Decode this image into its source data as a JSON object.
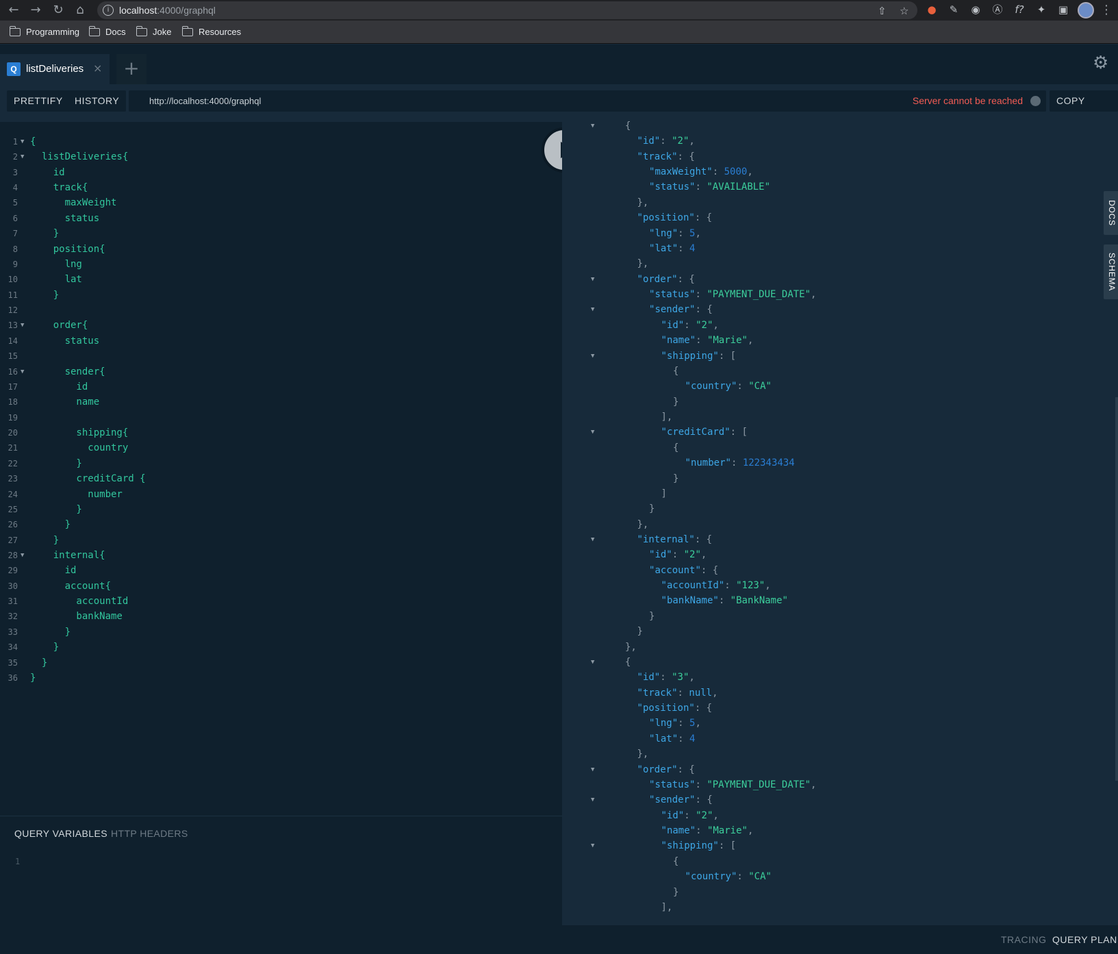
{
  "browser": {
    "url_host": "localhost",
    "url_rest": ":4000/graphql",
    "bookmarks": [
      "Programming",
      "Docs",
      "Joke",
      "Resources"
    ]
  },
  "playground": {
    "tab": {
      "badge": "Q",
      "label": "listDeliveries"
    },
    "toolbar": {
      "prettify": "PRETTIFY",
      "history": "HISTORY",
      "endpoint": "http://localhost:4000/graphql",
      "status": "Server cannot be reached",
      "copy_curl": "COPY CURL"
    },
    "query_lines": [
      {
        "n": "1",
        "fold": true,
        "text": "{"
      },
      {
        "n": "2",
        "fold": true,
        "text": "  listDeliveries{"
      },
      {
        "n": "3",
        "fold": false,
        "text": "    id"
      },
      {
        "n": "4",
        "fold": false,
        "text": "    track{"
      },
      {
        "n": "5",
        "fold": false,
        "text": "      maxWeight"
      },
      {
        "n": "6",
        "fold": false,
        "text": "      status"
      },
      {
        "n": "7",
        "fold": false,
        "text": "    }"
      },
      {
        "n": "8",
        "fold": false,
        "text": "    position{"
      },
      {
        "n": "9",
        "fold": false,
        "text": "      lng"
      },
      {
        "n": "10",
        "fold": false,
        "text": "      lat"
      },
      {
        "n": "11",
        "fold": false,
        "text": "    }"
      },
      {
        "n": "12",
        "fold": false,
        "text": ""
      },
      {
        "n": "13",
        "fold": true,
        "text": "    order{"
      },
      {
        "n": "14",
        "fold": false,
        "text": "      status"
      },
      {
        "n": "15",
        "fold": false,
        "text": ""
      },
      {
        "n": "16",
        "fold": true,
        "text": "      sender{"
      },
      {
        "n": "17",
        "fold": false,
        "text": "        id"
      },
      {
        "n": "18",
        "fold": false,
        "text": "        name"
      },
      {
        "n": "19",
        "fold": false,
        "text": ""
      },
      {
        "n": "20",
        "fold": false,
        "text": "        shipping{"
      },
      {
        "n": "21",
        "fold": false,
        "text": "          country"
      },
      {
        "n": "22",
        "fold": false,
        "text": "        }"
      },
      {
        "n": "23",
        "fold": false,
        "text": "        creditCard {"
      },
      {
        "n": "24",
        "fold": false,
        "text": "          number"
      },
      {
        "n": "25",
        "fold": false,
        "text": "        }"
      },
      {
        "n": "26",
        "fold": false,
        "text": "      }"
      },
      {
        "n": "27",
        "fold": false,
        "text": "    }"
      },
      {
        "n": "28",
        "fold": true,
        "text": "    internal{"
      },
      {
        "n": "29",
        "fold": false,
        "text": "      id"
      },
      {
        "n": "30",
        "fold": false,
        "text": "      account{"
      },
      {
        "n": "31",
        "fold": false,
        "text": "        accountId"
      },
      {
        "n": "32",
        "fold": false,
        "text": "        bankName"
      },
      {
        "n": "33",
        "fold": false,
        "text": "      }"
      },
      {
        "n": "34",
        "fold": false,
        "text": "    }"
      },
      {
        "n": "35",
        "fold": false,
        "text": "  }"
      },
      {
        "n": "36",
        "fold": false,
        "text": "}"
      }
    ],
    "variables": {
      "tab_variables": "QUERY VARIABLES",
      "tab_headers": "HTTP HEADERS",
      "line": "1"
    },
    "result_lines": [
      {
        "fold": true,
        "d": 0,
        "k": "",
        "v": "{",
        "vt": "p",
        "tail": ""
      },
      {
        "fold": false,
        "d": 1,
        "k": "id",
        "v": "\"2\"",
        "vt": "s",
        "tail": ","
      },
      {
        "fold": false,
        "d": 1,
        "k": "track",
        "v": "{",
        "vt": "p",
        "tail": ""
      },
      {
        "fold": false,
        "d": 2,
        "k": "maxWeight",
        "v": "5000",
        "vt": "n",
        "tail": ","
      },
      {
        "fold": false,
        "d": 2,
        "k": "status",
        "v": "\"AVAILABLE\"",
        "vt": "s",
        "tail": ""
      },
      {
        "fold": false,
        "d": 1,
        "k": "",
        "v": "},",
        "vt": "p",
        "tail": ""
      },
      {
        "fold": false,
        "d": 1,
        "k": "position",
        "v": "{",
        "vt": "p",
        "tail": ""
      },
      {
        "fold": false,
        "d": 2,
        "k": "lng",
        "v": "5",
        "vt": "n",
        "tail": ","
      },
      {
        "fold": false,
        "d": 2,
        "k": "lat",
        "v": "4",
        "vt": "n",
        "tail": ""
      },
      {
        "fold": false,
        "d": 1,
        "k": "",
        "v": "},",
        "vt": "p",
        "tail": ""
      },
      {
        "fold": true,
        "d": 1,
        "k": "order",
        "v": "{",
        "vt": "p",
        "tail": ""
      },
      {
        "fold": false,
        "d": 2,
        "k": "status",
        "v": "\"PAYMENT_DUE_DATE\"",
        "vt": "s",
        "tail": ","
      },
      {
        "fold": true,
        "d": 2,
        "k": "sender",
        "v": "{",
        "vt": "p",
        "tail": ""
      },
      {
        "fold": false,
        "d": 3,
        "k": "id",
        "v": "\"2\"",
        "vt": "s",
        "tail": ","
      },
      {
        "fold": false,
        "d": 3,
        "k": "name",
        "v": "\"Marie\"",
        "vt": "s",
        "tail": ","
      },
      {
        "fold": true,
        "d": 3,
        "k": "shipping",
        "v": "[",
        "vt": "p",
        "tail": ""
      },
      {
        "fold": false,
        "d": 4,
        "k": "",
        "v": "{",
        "vt": "p",
        "tail": ""
      },
      {
        "fold": false,
        "d": 5,
        "k": "country",
        "v": "\"CA\"",
        "vt": "s",
        "tail": ""
      },
      {
        "fold": false,
        "d": 4,
        "k": "",
        "v": "}",
        "vt": "p",
        "tail": ""
      },
      {
        "fold": false,
        "d": 3,
        "k": "",
        "v": "],",
        "vt": "p",
        "tail": ""
      },
      {
        "fold": true,
        "d": 3,
        "k": "creditCard",
        "v": "[",
        "vt": "p",
        "tail": ""
      },
      {
        "fold": false,
        "d": 4,
        "k": "",
        "v": "{",
        "vt": "p",
        "tail": ""
      },
      {
        "fold": false,
        "d": 5,
        "k": "number",
        "v": "122343434",
        "vt": "n",
        "tail": ""
      },
      {
        "fold": false,
        "d": 4,
        "k": "",
        "v": "}",
        "vt": "p",
        "tail": ""
      },
      {
        "fold": false,
        "d": 3,
        "k": "",
        "v": "]",
        "vt": "p",
        "tail": ""
      },
      {
        "fold": false,
        "d": 2,
        "k": "",
        "v": "}",
        "vt": "p",
        "tail": ""
      },
      {
        "fold": false,
        "d": 1,
        "k": "",
        "v": "},",
        "vt": "p",
        "tail": ""
      },
      {
        "fold": true,
        "d": 1,
        "k": "internal",
        "v": "{",
        "vt": "p",
        "tail": ""
      },
      {
        "fold": false,
        "d": 2,
        "k": "id",
        "v": "\"2\"",
        "vt": "s",
        "tail": ","
      },
      {
        "fold": false,
        "d": 2,
        "k": "account",
        "v": "{",
        "vt": "p",
        "tail": ""
      },
      {
        "fold": false,
        "d": 3,
        "k": "accountId",
        "v": "\"123\"",
        "vt": "s",
        "tail": ","
      },
      {
        "fold": false,
        "d": 3,
        "k": "bankName",
        "v": "\"BankName\"",
        "vt": "s",
        "tail": ""
      },
      {
        "fold": false,
        "d": 2,
        "k": "",
        "v": "}",
        "vt": "p",
        "tail": ""
      },
      {
        "fold": false,
        "d": 1,
        "k": "",
        "v": "}",
        "vt": "p",
        "tail": ""
      },
      {
        "fold": false,
        "d": 0,
        "k": "",
        "v": "},",
        "vt": "p",
        "tail": ""
      },
      {
        "fold": true,
        "d": 0,
        "k": "",
        "v": "{",
        "vt": "p",
        "tail": ""
      },
      {
        "fold": false,
        "d": 1,
        "k": "id",
        "v": "\"3\"",
        "vt": "s",
        "tail": ","
      },
      {
        "fold": false,
        "d": 1,
        "k": "track",
        "v": "null",
        "vt": "k",
        "tail": ","
      },
      {
        "fold": false,
        "d": 1,
        "k": "position",
        "v": "{",
        "vt": "p",
        "tail": ""
      },
      {
        "fold": false,
        "d": 2,
        "k": "lng",
        "v": "5",
        "vt": "n",
        "tail": ","
      },
      {
        "fold": false,
        "d": 2,
        "k": "lat",
        "v": "4",
        "vt": "n",
        "tail": ""
      },
      {
        "fold": false,
        "d": 1,
        "k": "",
        "v": "},",
        "vt": "p",
        "tail": ""
      },
      {
        "fold": true,
        "d": 1,
        "k": "order",
        "v": "{",
        "vt": "p",
        "tail": ""
      },
      {
        "fold": false,
        "d": 2,
        "k": "status",
        "v": "\"PAYMENT_DUE_DATE\"",
        "vt": "s",
        "tail": ","
      },
      {
        "fold": true,
        "d": 2,
        "k": "sender",
        "v": "{",
        "vt": "p",
        "tail": ""
      },
      {
        "fold": false,
        "d": 3,
        "k": "id",
        "v": "\"2\"",
        "vt": "s",
        "tail": ","
      },
      {
        "fold": false,
        "d": 3,
        "k": "name",
        "v": "\"Marie\"",
        "vt": "s",
        "tail": ","
      },
      {
        "fold": true,
        "d": 3,
        "k": "shipping",
        "v": "[",
        "vt": "p",
        "tail": ""
      },
      {
        "fold": false,
        "d": 4,
        "k": "",
        "v": "{",
        "vt": "p",
        "tail": ""
      },
      {
        "fold": false,
        "d": 5,
        "k": "country",
        "v": "\"CA\"",
        "vt": "s",
        "tail": ""
      },
      {
        "fold": false,
        "d": 4,
        "k": "",
        "v": "}",
        "vt": "p",
        "tail": ""
      },
      {
        "fold": false,
        "d": 3,
        "k": "",
        "v": "],",
        "vt": "p",
        "tail": ""
      }
    ],
    "side_tabs": [
      "DOCS",
      "SCHEMA"
    ],
    "bottom": {
      "tracing": "TRACING",
      "query_plan": "QUERY PLAN"
    }
  },
  "colors": {
    "accent_error": "#f25c54",
    "string": "#3ccf9c",
    "number": "#2a7ed3",
    "key": "#3ea7e6",
    "query": "#32c69d"
  }
}
